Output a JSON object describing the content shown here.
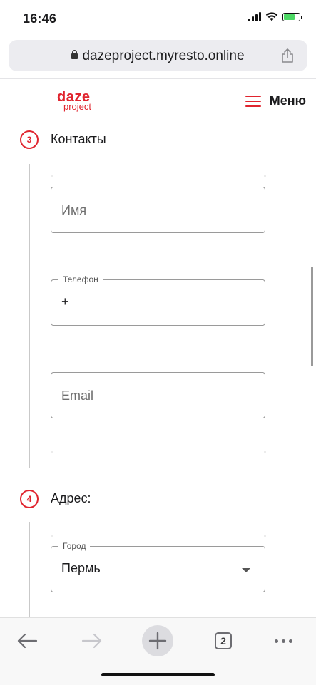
{
  "status_bar": {
    "time": "16:46",
    "battery_level": 0.7
  },
  "browser": {
    "url": "dazeproject.myresto.online",
    "tabs_count": "2"
  },
  "header": {
    "logo_line1": "daze",
    "logo_line2": "project",
    "menu_label": "Меню"
  },
  "steps": [
    {
      "number": "3",
      "title": "Контакты"
    },
    {
      "number": "4",
      "title": "Адрес:"
    }
  ],
  "contacts": {
    "name_placeholder": "Имя",
    "phone_label": "Телефон",
    "phone_value": "+",
    "email_placeholder": "Email"
  },
  "address": {
    "city_label": "Город",
    "city_value": "Пермь"
  },
  "colors": {
    "accent": "#e0242e",
    "page_bg": "#ffffff",
    "toolbar_bg": "#f8f8f8"
  }
}
